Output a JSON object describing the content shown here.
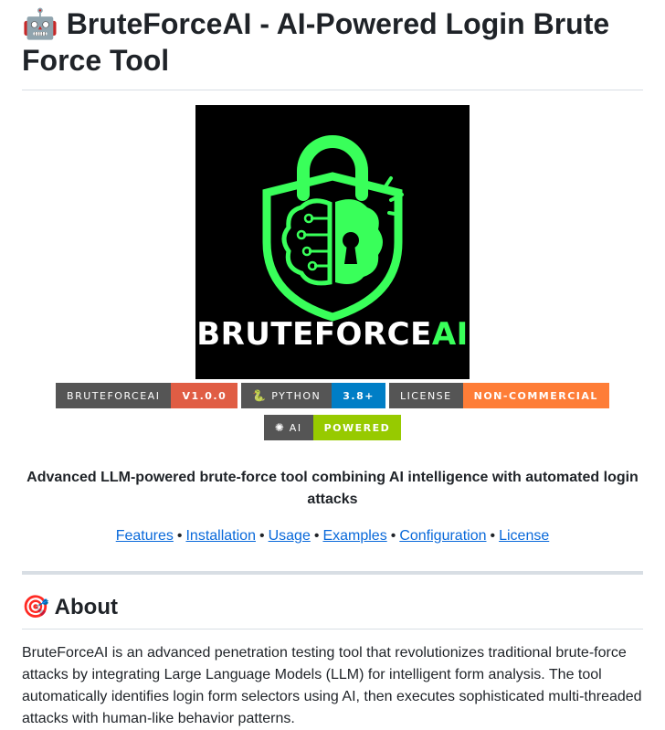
{
  "header": {
    "title_emoji": "🤖",
    "title": "BruteForceAI - AI-Powered Login Brute Force Tool"
  },
  "logo": {
    "alt": "BruteForceAI",
    "text_white": "BRUTEFORCE",
    "text_green": "AI",
    "accent_color": "#39ff5a"
  },
  "badges": [
    {
      "label": "BRUTEFORCEAI",
      "value": "V1.0.0",
      "color": "#e05d44"
    },
    {
      "label": "PYTHON",
      "value": "3.8+",
      "color": "#007ec6",
      "icon": "python-icon"
    },
    {
      "label": "LICENSE",
      "value": "NON-COMMERCIAL",
      "color": "#fe7d37"
    },
    {
      "label": "AI",
      "value": "POWERED",
      "color": "#97ca00",
      "icon": "openai-icon"
    }
  ],
  "tagline": "Advanced LLM-powered brute-force tool combining AI intelligence with automated login attacks",
  "nav": {
    "links": [
      "Features",
      "Installation",
      "Usage",
      "Examples",
      "Configuration",
      "License"
    ],
    "separator": "•"
  },
  "about": {
    "emoji": "🎯",
    "heading": "About",
    "text": "BruteForceAI is an advanced penetration testing tool that revolutionizes traditional brute-force attacks by integrating Large Language Models (LLM) for intelligent form analysis. The tool automatically identifies login form selectors using AI, then executes sophisticated multi-threaded attacks with human-like behavior patterns."
  }
}
